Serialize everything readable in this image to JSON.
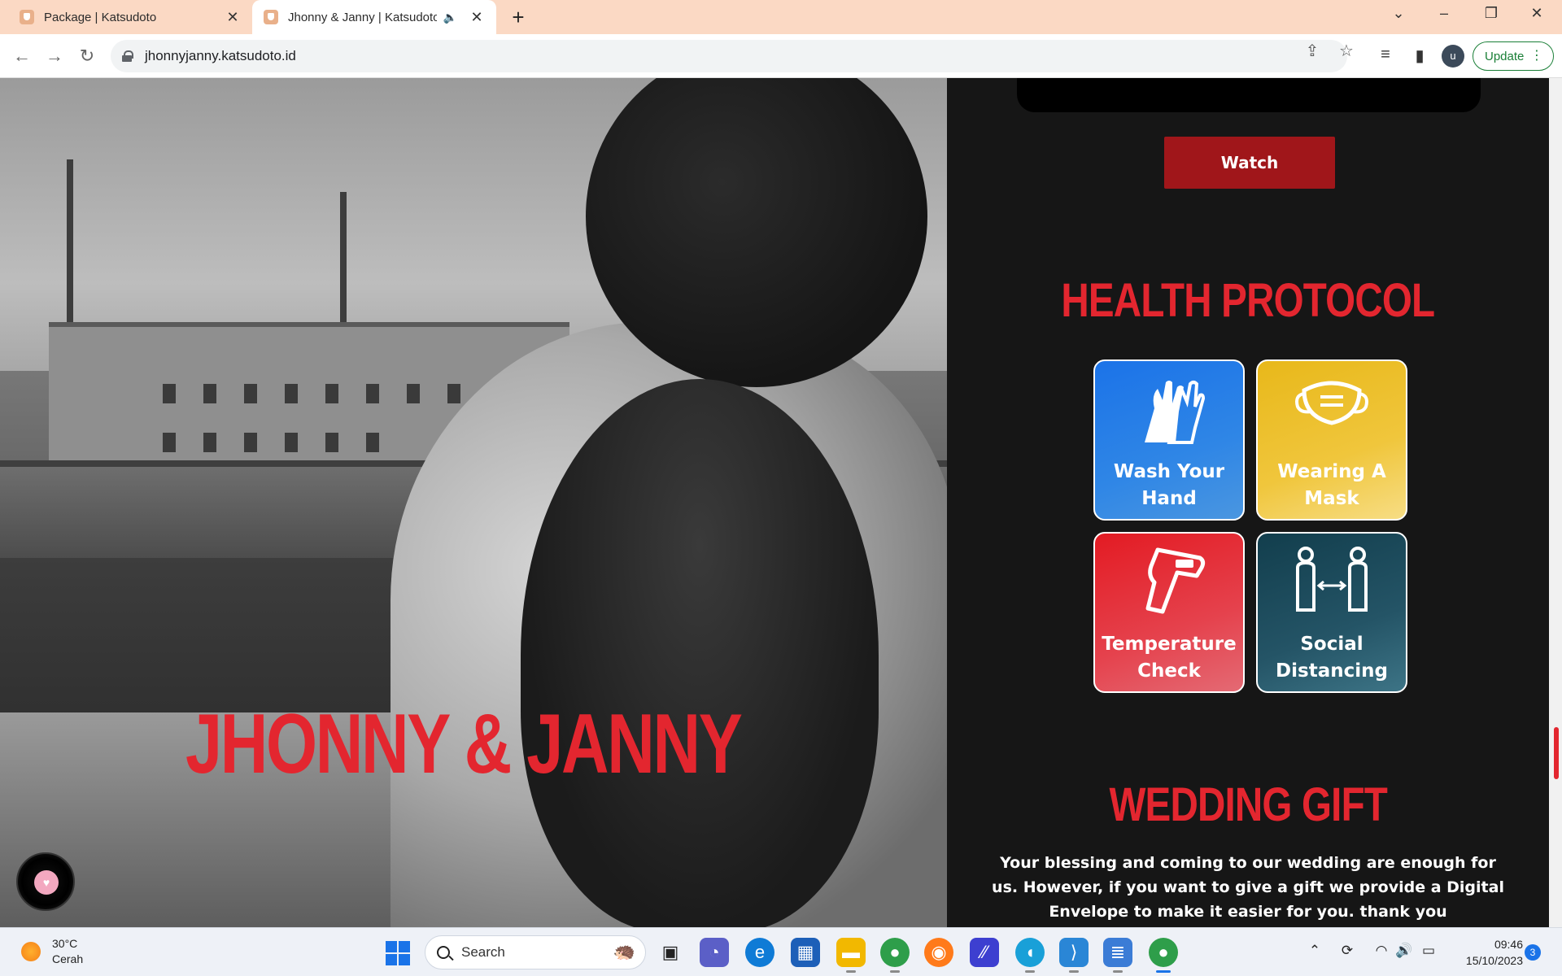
{
  "browser": {
    "tabs": [
      {
        "title": "Package | Katsudoto",
        "active": false
      },
      {
        "title": "Jhonny & Janny | Katsudoto",
        "active": true
      }
    ],
    "url": "jhonnyjanny.katsudoto.id",
    "profile_initial": "u",
    "update_label": "Update"
  },
  "hero": {
    "couple_names": "JHONNY & JANNY"
  },
  "panel": {
    "watch_label": "Watch",
    "health_title": "HEALTH PROTOCOL",
    "protocols": [
      {
        "label_line1": "Wash Your",
        "label_line2": "Hand",
        "icon": "hands-icon",
        "color": "#1b73e8"
      },
      {
        "label_line1": "Wearing A",
        "label_line2": "Mask",
        "icon": "mask-icon",
        "color": "#e8b81a"
      },
      {
        "label_line1": "Temperature",
        "label_line2": "Check",
        "icon": "thermometer-gun-icon",
        "color": "#e31b23"
      },
      {
        "label_line1": "Social",
        "label_line2": "Distancing",
        "icon": "distancing-icon",
        "color": "#123e4d"
      }
    ],
    "gift_title": "WEDDING GIFT",
    "gift_text": "Your blessing and coming to our wedding are enough for us. However, if you want to give a gift we provide a Digital Envelope to make it easier for you. thank you"
  },
  "taskbar": {
    "weather_temp": "30°C",
    "weather_desc": "Cerah",
    "search_placeholder": "Search",
    "time": "09:46",
    "date": "15/10/2023",
    "notification_count": "3"
  },
  "colors": {
    "accent_red": "#e3262f",
    "watch_button": "#a0161a",
    "panel_bg": "#161616"
  }
}
